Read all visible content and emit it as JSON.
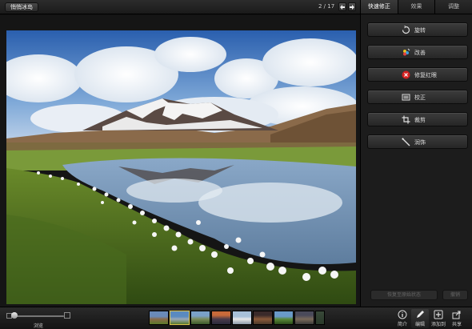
{
  "topbar": {
    "album_button": "悄悄冰岛",
    "counter": "2 / 17"
  },
  "panel": {
    "tabs": [
      {
        "label": "快速修正",
        "active": true
      },
      {
        "label": "效果",
        "active": false
      },
      {
        "label": "调整",
        "active": false
      }
    ],
    "tools": [
      {
        "label": "旋转",
        "icon": "rotate-icon"
      },
      {
        "label": "改善",
        "icon": "enhance-icon"
      },
      {
        "label": "修复红眼",
        "icon": "red-eye-icon"
      },
      {
        "label": "校正",
        "icon": "straighten-icon"
      },
      {
        "label": "裁剪",
        "icon": "crop-icon"
      },
      {
        "label": "润饰",
        "icon": "retouch-icon"
      }
    ],
    "restore_button": "恢复至原始状态",
    "undo_button": "撤销"
  },
  "bottombar": {
    "browse_label": "浏览",
    "actions": [
      {
        "label": "简介",
        "icon": "info-icon",
        "active": false
      },
      {
        "label": "编辑",
        "icon": "edit-icon",
        "active": true
      },
      {
        "label": "添加到",
        "icon": "add-to-icon",
        "active": false
      },
      {
        "label": "共享",
        "icon": "share-icon",
        "active": false
      }
    ],
    "thumbnail_count": 9,
    "selected_thumbnail": 2
  },
  "colors": {
    "accent_selected": "#d9c24a",
    "red_eye": "#d42020"
  }
}
